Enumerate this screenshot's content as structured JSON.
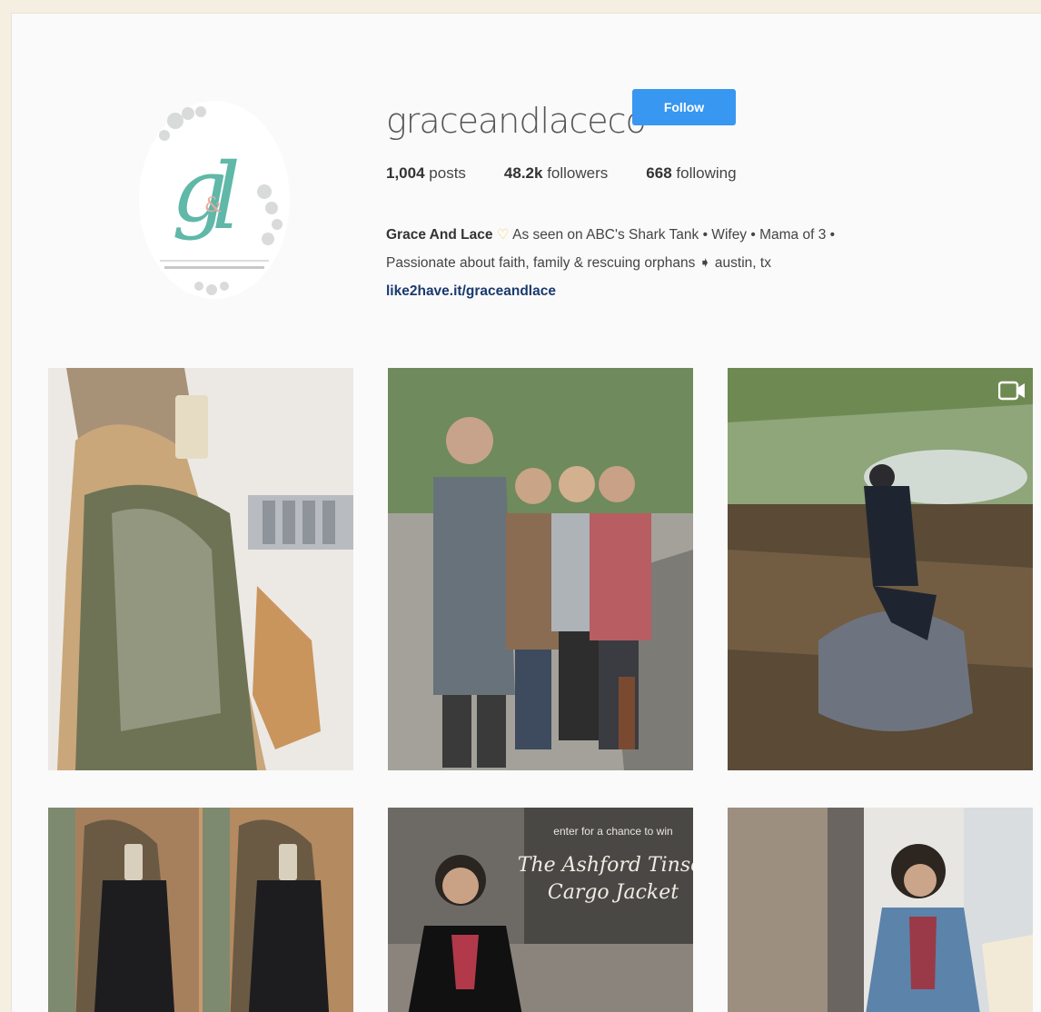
{
  "profile": {
    "username": "graceandlaceco",
    "follow_label": "Follow",
    "avatar_monogram": "g&l",
    "stats": {
      "posts_count": "1,004",
      "posts_label": "posts",
      "followers_count": "48.2k",
      "followers_label": "followers",
      "following_count": "668",
      "following_label": "following"
    },
    "bio": {
      "name": "Grace And Lace",
      "line1": "As seen on ABC's Shark Tank • Wifey • Mama of 3 •",
      "line2": "Passionate about faith, family & rescuing orphans ➧ austin, tx",
      "link": "like2have.it/graceandlace"
    }
  },
  "posts": [
    {
      "caption": "",
      "type": "photo"
    },
    {
      "caption": "",
      "type": "photo"
    },
    {
      "caption": "",
      "type": "video"
    },
    {
      "caption": "",
      "type": "photo"
    },
    {
      "caption": "enter for a chance to win",
      "overlay_title": "The Ashford Tinsel Cargo Jacket",
      "type": "photo"
    },
    {
      "caption": "",
      "type": "photo"
    }
  ],
  "colors": {
    "follow_button": "#3897f0",
    "link": "#1b3a6e",
    "logo_teal": "#5fb8a8",
    "logo_pink": "#e8a9a0"
  }
}
